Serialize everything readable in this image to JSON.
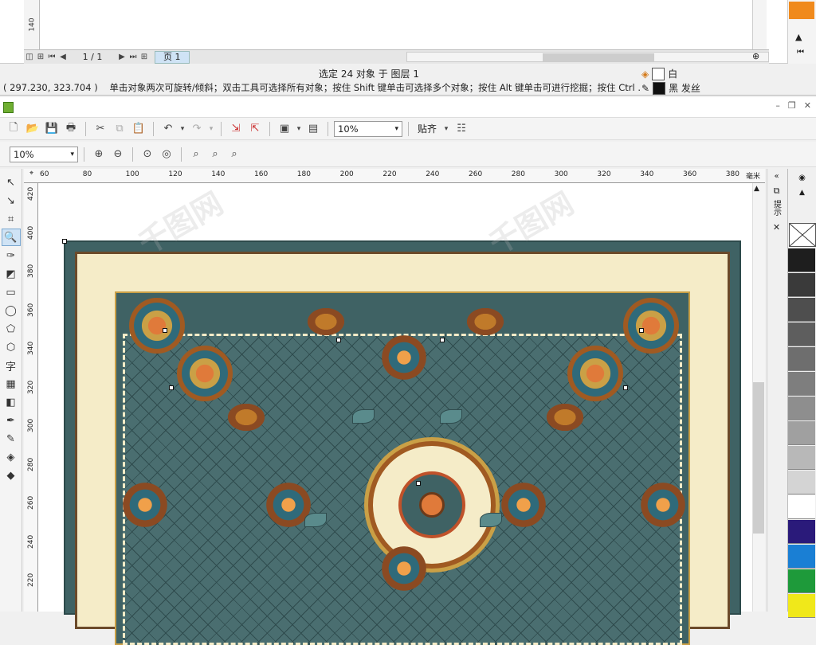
{
  "prev_window": {
    "vruler_tick": "140",
    "vruler_unit": "毫米",
    "page_counter": "1 / 1",
    "page_tab": "页 1"
  },
  "status": {
    "selection_text": "选定 24 对象 于 图层 1",
    "coords": "( 297.230, 323.704 )",
    "hint": "单击对象两次可旋转/倾斜；双击工具可选择所有对象；按住 Shift 键单击可选择多个对象；按住 Alt 键单击可进行挖掘；按住 Ctrl ...",
    "fill_label": "白",
    "fill_color": "#ffffff",
    "outline_label": "黑 发丝",
    "outline_color": "#111111"
  },
  "toolbar": {
    "zoom_value": "10%",
    "snap_label": "贴齐",
    "zoom_tb_value": "10%"
  },
  "ruler": {
    "h_ticks": [
      "60",
      "80",
      "100",
      "120",
      "140",
      "160",
      "180",
      "200",
      "220",
      "240",
      "260",
      "280",
      "300",
      "320",
      "340",
      "360",
      "380"
    ],
    "v_ticks": [
      "420",
      "400",
      "380",
      "360",
      "340",
      "320",
      "300",
      "280",
      "260",
      "240",
      "220"
    ],
    "unit": "毫米"
  },
  "palette": {
    "colors": [
      "#1e1e1e",
      "#3a3a3a",
      "#4e4e4e",
      "#5e5e5e",
      "#6e6e6e",
      "#7e7e7e",
      "#8e8e8e",
      "#a0a0a0",
      "#b8b8b8",
      "#d4d4d4",
      "#ffffff",
      "#2a1a7a",
      "#1a7fd4",
      "#1e9a3a",
      "#f0e81a"
    ]
  },
  "docker": {
    "label": "提示"
  },
  "canvas": {
    "watermark": "千图网"
  }
}
